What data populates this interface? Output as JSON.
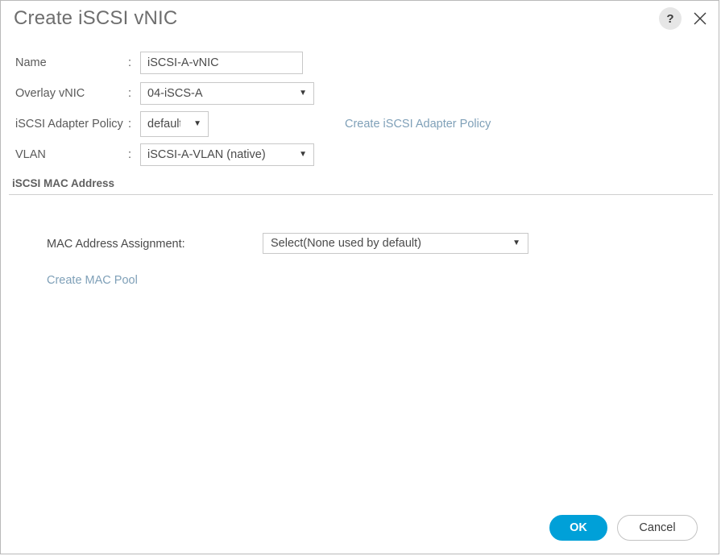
{
  "dialog": {
    "title": "Create iSCSI vNIC",
    "help_icon_label": "?",
    "help_icon_name": "question-mark-icon",
    "close_icon_name": "close-icon"
  },
  "form": {
    "rows": [
      {
        "label": "Name",
        "colon": ":",
        "type": "text",
        "value": "iSCSI-A-vNIC"
      },
      {
        "label": "Overlay vNIC",
        "colon": ":",
        "type": "select",
        "value": "04-iSCS-A",
        "caret": "▼"
      },
      {
        "label": "iSCSI Adapter Policy",
        "colon": ":",
        "type": "select",
        "value": "default",
        "caret": "▼",
        "link": "Create iSCSI Adapter Policy"
      },
      {
        "label": "VLAN",
        "colon": ":",
        "type": "select",
        "value": "iSCSI-A-VLAN (native)",
        "caret": "▼"
      }
    ]
  },
  "mac_section": {
    "title": "iSCSI MAC Address",
    "assignment_label": "MAC Address Assignment:",
    "assignment_value": "Select(None used by default)",
    "assignment_caret": "▼",
    "create_pool_link": "Create MAC Pool"
  },
  "footer": {
    "ok_label": "OK",
    "cancel_label": "Cancel"
  },
  "colors": {
    "accent_blue": "#00a0d8",
    "link_blue": "#7fa0b8",
    "text_gray": "#5a5a5a",
    "border_gray": "#c8c8c8"
  }
}
